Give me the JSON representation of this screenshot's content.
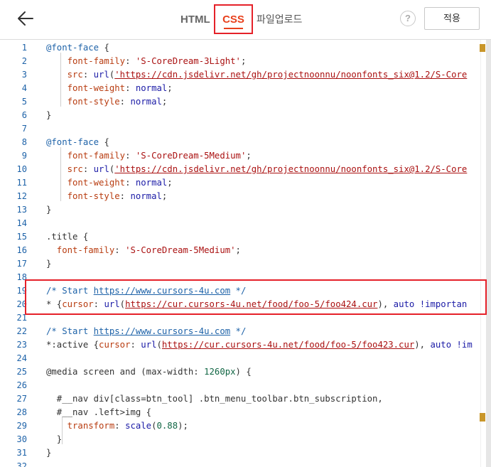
{
  "header": {
    "tabs": {
      "html": "HTML",
      "css": "CSS",
      "upload": "파일업로드"
    },
    "help_label": "?",
    "apply_label": "적용"
  },
  "editor": {
    "lines": [
      {
        "n": "1",
        "t": [
          [
            "at",
            "@font-face"
          ],
          [
            "sel",
            " {"
          ]
        ]
      },
      {
        "n": "2",
        "t": [
          [
            "prop",
            "    font-family"
          ],
          [
            "sel",
            ": "
          ],
          [
            "str",
            "'S-CoreDream-3Light'"
          ],
          [
            "sel",
            ";"
          ]
        ]
      },
      {
        "n": "3",
        "t": [
          [
            "prop",
            "    src"
          ],
          [
            "sel",
            ": "
          ],
          [
            "val",
            "url"
          ],
          [
            "sel",
            "("
          ],
          [
            "url",
            "'https://cdn.jsdelivr.net/gh/projectnoonnu/noonfonts_six@1.2/S-Core"
          ]
        ]
      },
      {
        "n": "4",
        "t": [
          [
            "prop",
            "    font-weight"
          ],
          [
            "sel",
            ": "
          ],
          [
            "val",
            "normal"
          ],
          [
            "sel",
            ";"
          ]
        ]
      },
      {
        "n": "5",
        "t": [
          [
            "prop",
            "    font-style"
          ],
          [
            "sel",
            ": "
          ],
          [
            "val",
            "normal"
          ],
          [
            "sel",
            ";"
          ]
        ]
      },
      {
        "n": "6",
        "t": [
          [
            "sel",
            "}"
          ]
        ]
      },
      {
        "n": "7",
        "t": []
      },
      {
        "n": "8",
        "t": [
          [
            "at",
            "@font-face"
          ],
          [
            "sel",
            " {"
          ]
        ]
      },
      {
        "n": "9",
        "t": [
          [
            "prop",
            "    font-family"
          ],
          [
            "sel",
            ": "
          ],
          [
            "str",
            "'S-CoreDream-5Medium'"
          ],
          [
            "sel",
            ";"
          ]
        ]
      },
      {
        "n": "10",
        "t": [
          [
            "prop",
            "    src"
          ],
          [
            "sel",
            ": "
          ],
          [
            "val",
            "url"
          ],
          [
            "sel",
            "("
          ],
          [
            "url",
            "'https://cdn.jsdelivr.net/gh/projectnoonnu/noonfonts_six@1.2/S-Core"
          ]
        ]
      },
      {
        "n": "11",
        "t": [
          [
            "prop",
            "    font-weight"
          ],
          [
            "sel",
            ": "
          ],
          [
            "val",
            "normal"
          ],
          [
            "sel",
            ";"
          ]
        ]
      },
      {
        "n": "12",
        "t": [
          [
            "prop",
            "    font-style"
          ],
          [
            "sel",
            ": "
          ],
          [
            "val",
            "normal"
          ],
          [
            "sel",
            ";"
          ]
        ]
      },
      {
        "n": "13",
        "t": [
          [
            "sel",
            "}"
          ]
        ]
      },
      {
        "n": "14",
        "t": []
      },
      {
        "n": "15",
        "t": [
          [
            "sel",
            ".title {"
          ]
        ]
      },
      {
        "n": "16",
        "t": [
          [
            "prop",
            "  font-family"
          ],
          [
            "sel",
            ": "
          ],
          [
            "str",
            "'S-CoreDream-5Medium'"
          ],
          [
            "sel",
            ";"
          ]
        ]
      },
      {
        "n": "17",
        "t": [
          [
            "sel",
            "}"
          ]
        ]
      },
      {
        "n": "18",
        "t": []
      },
      {
        "n": "19",
        "t": [
          [
            "cmt",
            "/* Start "
          ],
          [
            "link",
            "https://www.cursors-4u.com"
          ],
          [
            "cmt",
            " */"
          ]
        ]
      },
      {
        "n": "20",
        "t": [
          [
            "sel",
            "* {"
          ],
          [
            "prop",
            "cursor"
          ],
          [
            "sel",
            ": "
          ],
          [
            "val",
            "url"
          ],
          [
            "sel",
            "("
          ],
          [
            "url",
            "https://cur.cursors-4u.net/food/foo-5/foo424.cur"
          ],
          [
            "sel",
            "), "
          ],
          [
            "val",
            "auto !importan"
          ]
        ]
      },
      {
        "n": "21",
        "t": []
      },
      {
        "n": "22",
        "t": [
          [
            "cmt",
            "/* Start "
          ],
          [
            "link",
            "https://www.cursors-4u.com"
          ],
          [
            "cmt",
            " */"
          ]
        ]
      },
      {
        "n": "23",
        "t": [
          [
            "sel",
            "*:active {"
          ],
          [
            "prop",
            "cursor"
          ],
          [
            "sel",
            ": "
          ],
          [
            "val",
            "url"
          ],
          [
            "sel",
            "("
          ],
          [
            "url",
            "https://cur.cursors-4u.net/food/foo-5/foo423.cur"
          ],
          [
            "sel",
            "), "
          ],
          [
            "val",
            "auto !im"
          ]
        ]
      },
      {
        "n": "24",
        "t": []
      },
      {
        "n": "25",
        "t": [
          [
            "sel",
            "@media screen and (max-width: "
          ],
          [
            "num",
            "1260px"
          ],
          [
            "sel",
            ") {"
          ]
        ]
      },
      {
        "n": "26",
        "t": []
      },
      {
        "n": "27",
        "t": [
          [
            "sel",
            "  #__nav div[class=btn_tool] .btn_menu_toolbar.btn_subscription,"
          ]
        ]
      },
      {
        "n": "28",
        "t": [
          [
            "sel",
            "  #__nav .left>img {"
          ]
        ]
      },
      {
        "n": "29",
        "t": [
          [
            "prop",
            "    transform"
          ],
          [
            "sel",
            ": "
          ],
          [
            "val",
            "scale"
          ],
          [
            "sel",
            "("
          ],
          [
            "num",
            "0.88"
          ],
          [
            "sel",
            ");"
          ]
        ]
      },
      {
        "n": "30",
        "t": [
          [
            "sel",
            "  }"
          ]
        ]
      },
      {
        "n": "31",
        "t": [
          [
            "sel",
            "}"
          ]
        ]
      },
      {
        "n": "32",
        "t": []
      }
    ]
  }
}
